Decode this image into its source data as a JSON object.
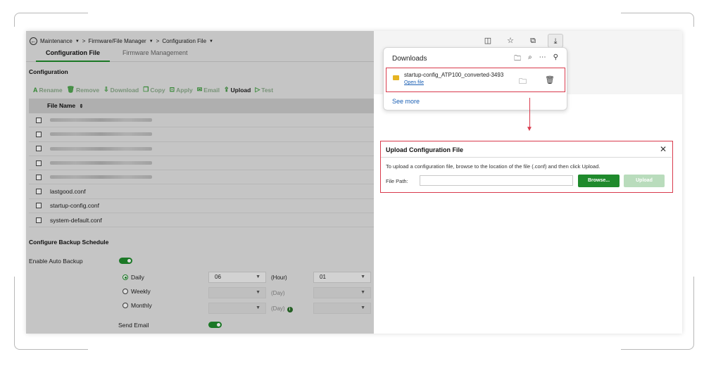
{
  "breadcrumb": {
    "back_icon": "back-arrow-circle-icon",
    "level1": "Maintenance",
    "sep": ">",
    "level2": "Firmware/File Manager",
    "level3": "Configuration File",
    "caret": "▼"
  },
  "tabs": [
    {
      "label": "Configuration File",
      "active": true
    },
    {
      "label": "Firmware Management",
      "active": false
    }
  ],
  "config_section": {
    "title": "Configuration",
    "toolbar": [
      {
        "label": "Rename",
        "icon": "rename-icon",
        "glyph": "A",
        "enabled": false
      },
      {
        "label": "Remove",
        "icon": "trash-icon",
        "glyph": "🗑",
        "enabled": false
      },
      {
        "label": "Download",
        "icon": "download-icon",
        "glyph": "⇩",
        "enabled": false
      },
      {
        "label": "Copy",
        "icon": "copy-icon",
        "glyph": "❐",
        "enabled": false
      },
      {
        "label": "Apply",
        "icon": "apply-icon",
        "glyph": "⊡",
        "enabled": false
      },
      {
        "label": "Email",
        "icon": "email-icon",
        "glyph": "✉",
        "enabled": false
      },
      {
        "label": "Upload",
        "icon": "upload-icon",
        "glyph": "⇪",
        "enabled": true
      },
      {
        "label": "Test",
        "icon": "play-icon",
        "glyph": "▷",
        "enabled": false
      }
    ],
    "column_header": "File Name",
    "sort_icon": "⇕",
    "files": [
      {
        "name": "",
        "blurred": true
      },
      {
        "name": "",
        "blurred": true
      },
      {
        "name": "",
        "blurred": true
      },
      {
        "name": "",
        "blurred": true
      },
      {
        "name": "",
        "blurred": true
      },
      {
        "name": "lastgood.conf",
        "blurred": false
      },
      {
        "name": "startup-config.conf",
        "blurred": false
      },
      {
        "name": "system-default.conf",
        "blurred": false
      }
    ]
  },
  "backup_section": {
    "title": "Configure Backup Schedule",
    "enable_label": "Enable Auto Backup",
    "enable_on": true,
    "options": [
      {
        "label": "Daily",
        "selected": true
      },
      {
        "label": "Weekly",
        "selected": false
      },
      {
        "label": "Monthly",
        "selected": false
      }
    ],
    "daily": {
      "hour_value": "06",
      "hour_unit": "(Hour)",
      "minute_value": "01"
    },
    "weekly_unit": "(Day)",
    "monthly_unit": "(Day)",
    "send_email_label": "Send Email",
    "send_email_on": true
  },
  "browser": {
    "toolbar_icons": [
      "split-screen-icon",
      "favorites-icon",
      "collections-icon",
      "downloads-icon"
    ],
    "downloads": {
      "title": "Downloads",
      "header_icons": [
        "folder-icon",
        "search-icon",
        "more-icon",
        "pin-icon"
      ],
      "file_name": "startup-config_ATP100_converted-3493",
      "open_file": "Open file",
      "see_more": "See more"
    }
  },
  "upload_dialog": {
    "title": "Upload Configuration File",
    "close": "✕",
    "description": "To upload a configuration file, browse to the location of the file (.conf) and then click Upload.",
    "file_path_label": "File Path:",
    "file_path_value": "",
    "browse_label": "Browse...",
    "upload_label": "Upload"
  },
  "colors": {
    "accent_green": "#1f8a2c",
    "highlight_red": "#d93a4c",
    "link_blue": "#1a5fb4"
  }
}
